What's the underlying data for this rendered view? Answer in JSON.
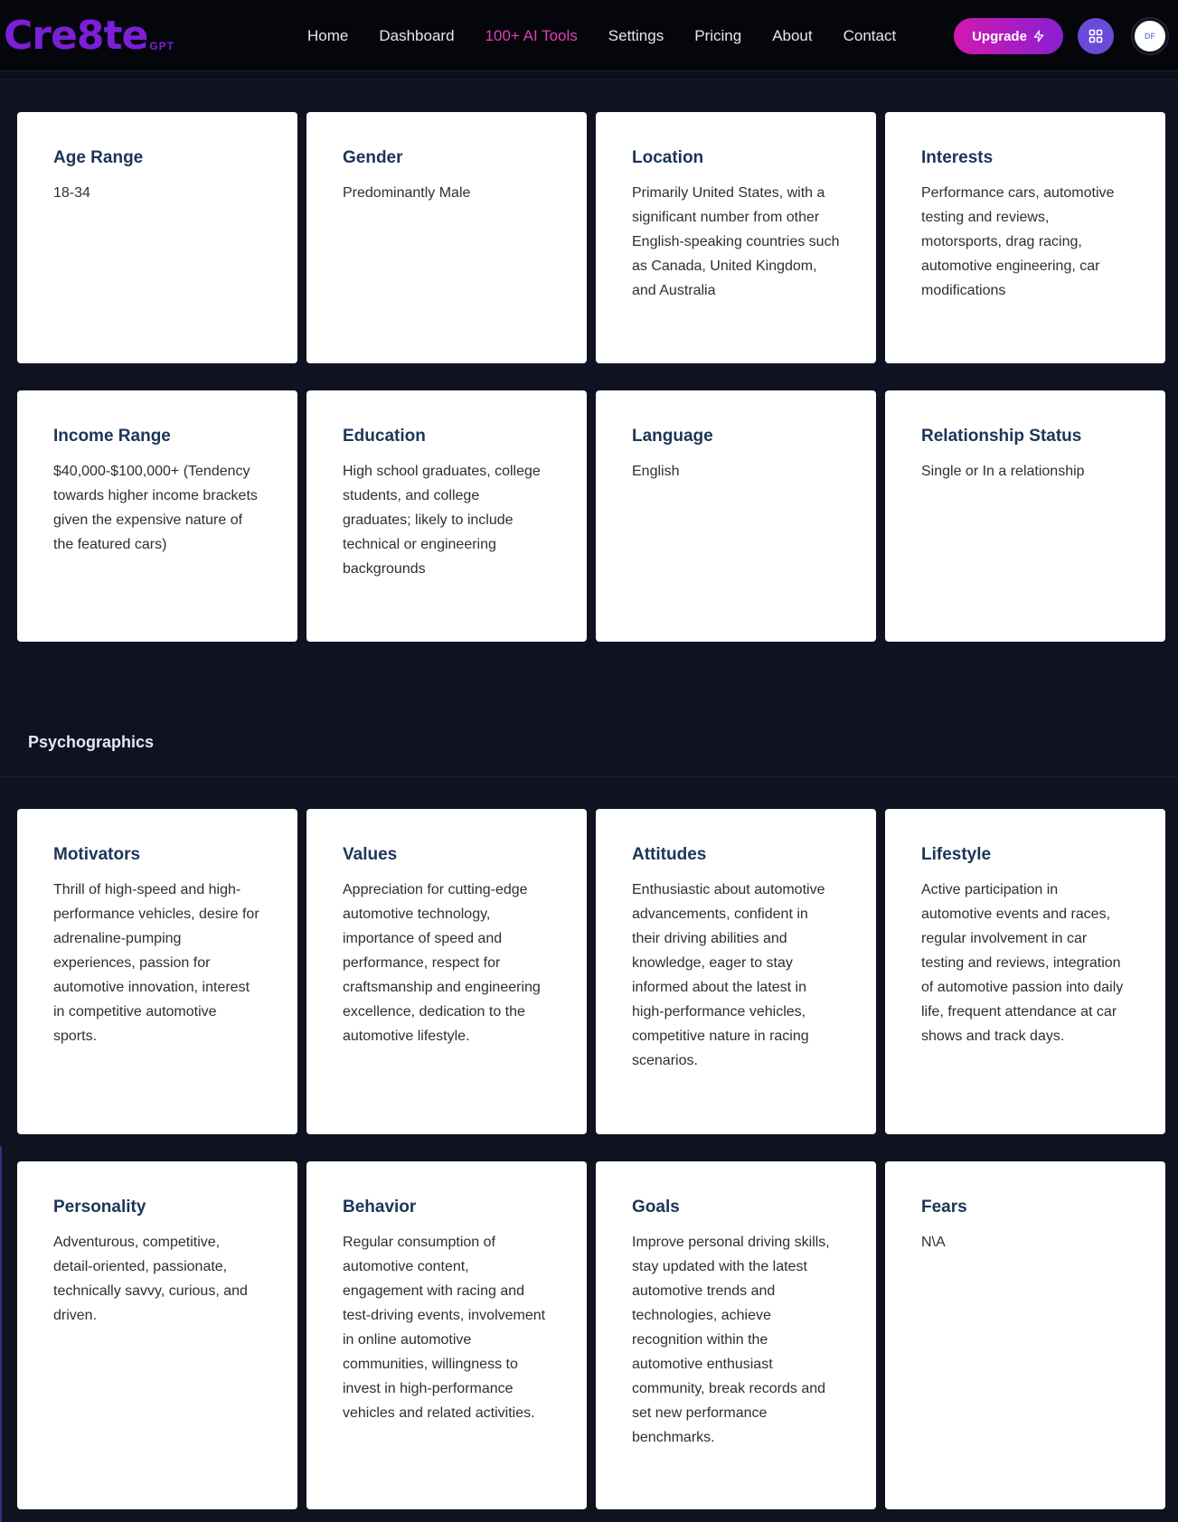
{
  "brand": {
    "logo": "Cre8te",
    "logo_suffix": "GPT"
  },
  "nav": {
    "links": [
      "Home",
      "Dashboard",
      "100+ AI Tools",
      "Settings",
      "Pricing",
      "About",
      "Contact"
    ],
    "active_index": 2,
    "upgrade_label": "Upgrade",
    "avatar_initials": "DF"
  },
  "colors": {
    "accent": "#e13fb5",
    "upgrade_gradient_start": "#d11ab0",
    "upgrade_gradient_end": "#8a1fd0",
    "logo": "#7c1fd6",
    "apps_button": "#6a4bd8",
    "card_title": "#1c3557",
    "background": "#0f1221"
  },
  "demographics": [
    {
      "title": "Age Range",
      "text": "18-34"
    },
    {
      "title": "Gender",
      "text": "Predominantly Male"
    },
    {
      "title": "Location",
      "text": "Primarily United States, with a significant number from other English-speaking countries such as Canada, United Kingdom, and Australia"
    },
    {
      "title": "Interests",
      "text": "Performance cars, automotive testing and reviews, motorsports, drag racing, automotive engineering, car modifications"
    },
    {
      "title": "Income Range",
      "text": "$40,000-$100,000+ (Tendency towards higher income brackets given the expensive nature of the featured cars)"
    },
    {
      "title": "Education",
      "text": "High school graduates, college students, and college graduates; likely to include technical or engineering backgrounds"
    },
    {
      "title": "Language",
      "text": "English"
    },
    {
      "title": "Relationship Status",
      "text": "Single or In a relationship"
    }
  ],
  "psychographics": {
    "section_title": "Psychographics",
    "cards": [
      {
        "title": "Motivators",
        "text": "Thrill of high-speed and high-performance vehicles, desire for adrenaline-pumping experiences, passion for automotive innovation, interest in competitive automotive sports."
      },
      {
        "title": "Values",
        "text": "Appreciation for cutting-edge automotive technology, importance of speed and performance, respect for craftsmanship and engineering excellence, dedication to the automotive lifestyle."
      },
      {
        "title": "Attitudes",
        "text": "Enthusiastic about automotive advancements, confident in their driving abilities and knowledge, eager to stay informed about the latest in high-performance vehicles, competitive nature in racing scenarios."
      },
      {
        "title": "Lifestyle",
        "text": "Active participation in automotive events and races, regular involvement in car testing and reviews, integration of automotive passion into daily life, frequent attendance at car shows and track days."
      },
      {
        "title": "Personality",
        "text": "Adventurous, competitive, detail-oriented, passionate, technically savvy, curious, and driven."
      },
      {
        "title": "Behavior",
        "text": "Regular consumption of automotive content, engagement with racing and test-driving events, involvement in online automotive communities, willingness to invest in high-performance vehicles and related activities."
      },
      {
        "title": "Goals",
        "text": "Improve personal driving skills, stay updated with the latest automotive trends and technologies, achieve recognition within the automotive enthusiast community, break records and set new performance benchmarks."
      },
      {
        "title": "Fears",
        "text": "N\\A"
      }
    ]
  }
}
